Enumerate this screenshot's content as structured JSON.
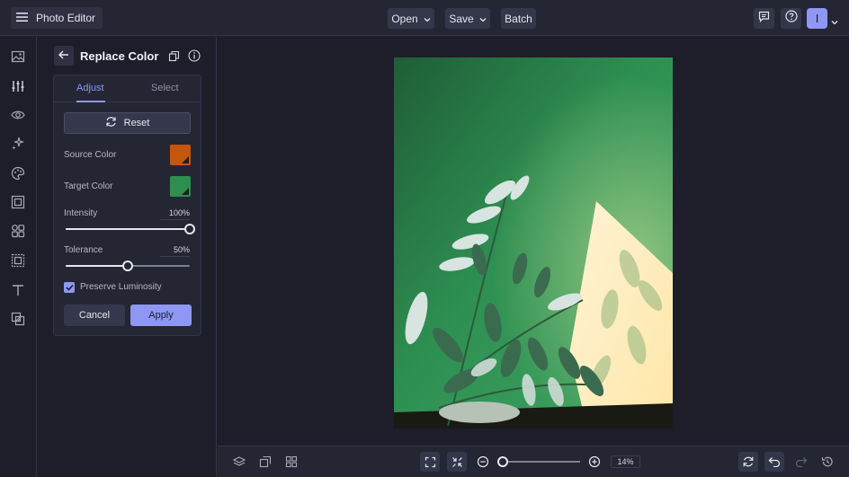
{
  "app": {
    "title": "Photo Editor"
  },
  "toolbar": {
    "open_label": "Open",
    "save_label": "Save",
    "batch_label": "Batch",
    "avatar_initial": "I"
  },
  "rail": {
    "items": [
      "image-icon",
      "adjust-sliders-icon",
      "eye-icon",
      "sparkle-effects-icon",
      "paint-palette-icon",
      "frame-icon",
      "graphics-icon",
      "texture-frame-icon",
      "text-icon",
      "overlay-icon"
    ],
    "active": "adjust-sliders-icon"
  },
  "panel": {
    "title": "Replace Color",
    "tabs": [
      {
        "label": "Adjust",
        "active": true
      },
      {
        "label": "Select",
        "active": false
      }
    ],
    "reset_label": "Reset",
    "source_color_label": "Source Color",
    "source_color": "#c2570d",
    "target_color_label": "Target Color",
    "target_color": "#2e8f4e",
    "intensity_label": "Intensity",
    "intensity_value": "100%",
    "intensity_level": 1.0,
    "tolerance_label": "Tolerance",
    "tolerance_value": "50%",
    "tolerance_level": 0.5,
    "preserve_label": "Preserve Luminosity",
    "preserve_checked": true,
    "cancel_label": "Cancel",
    "apply_label": "Apply"
  },
  "bottom": {
    "zoom_value": "14%"
  },
  "colors": {
    "accent": "#8e97f3",
    "background": "#1d1e2a",
    "panel": "#252634"
  }
}
